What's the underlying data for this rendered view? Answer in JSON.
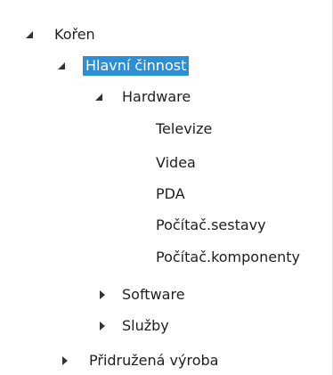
{
  "tree": {
    "colors": {
      "selected_bg": "#2a8fd6",
      "selected_fg": "#ffffff",
      "arrow": "#333333"
    },
    "nodes": [
      {
        "id": "koren",
        "label": "Kořen",
        "state": "expanded",
        "selected": false
      },
      {
        "id": "hlavni",
        "label": "Hlavní činnost",
        "state": "expanded",
        "selected": true
      },
      {
        "id": "hardware",
        "label": "Hardware",
        "state": "expanded",
        "selected": false
      },
      {
        "id": "televize",
        "label": "Televize",
        "state": "leaf",
        "selected": false
      },
      {
        "id": "videa",
        "label": "Videa",
        "state": "leaf",
        "selected": false
      },
      {
        "id": "pda",
        "label": "PDA",
        "state": "leaf",
        "selected": false
      },
      {
        "id": "sestavy",
        "label": "Počítač.sestavy",
        "state": "leaf",
        "selected": false
      },
      {
        "id": "komponenty",
        "label": "Počítač.komponenty",
        "state": "leaf",
        "selected": false
      },
      {
        "id": "software",
        "label": "Software",
        "state": "collapsed",
        "selected": false
      },
      {
        "id": "sluzby",
        "label": "Služby",
        "state": "collapsed",
        "selected": false
      },
      {
        "id": "pridruzena",
        "label": "Přidružená výroba",
        "state": "collapsed",
        "selected": false
      }
    ]
  }
}
